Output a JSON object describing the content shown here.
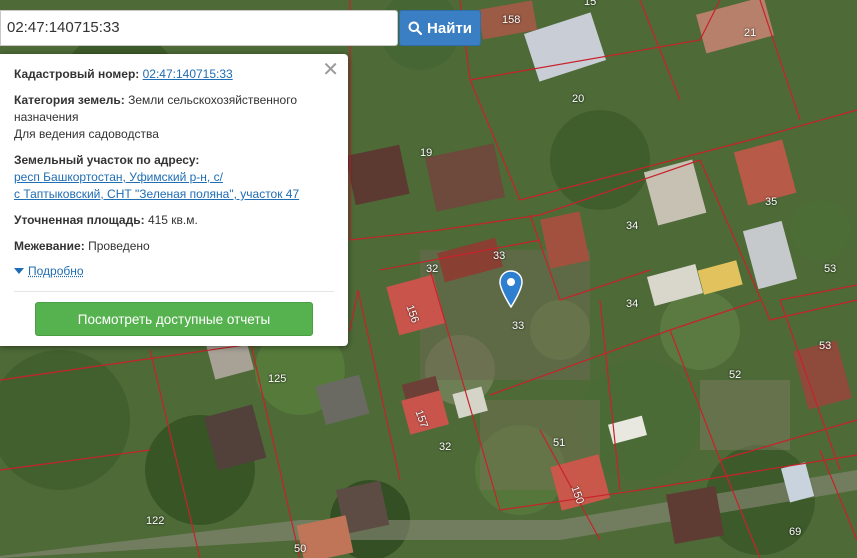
{
  "search": {
    "value": "02:47:140715:33",
    "button_label": "Найти"
  },
  "info": {
    "cadastral_label": "Кадастровый номер:",
    "cadastral_value": "02:47:140715:33",
    "category_label": "Категория земель:",
    "category_value": "Земли сельскохозяйственного назначения",
    "use": "Для ведения садоводства",
    "address_label": "Земельный участок по адресу:",
    "address_line1": "респ Башкортостан, Уфимский р-н, с/",
    "address_line2": "с Таптыковский, СНТ \"Зеленая поляна\", участок 47",
    "area_label": "Уточненная площадь:",
    "area_value": "415 кв.м.",
    "survey_label": "Межевание:",
    "survey_value": "Проведено",
    "more_label": "Подробно",
    "report_button": "Посмотреть доступные отчеты"
  },
  "map": {
    "parcel_numbers": [
      "158",
      "15",
      "21",
      "20",
      "19",
      "35",
      "34",
      "33",
      "32",
      "53",
      "156",
      "52",
      "125",
      "157",
      "51",
      "150",
      "122",
      "50",
      "69"
    ],
    "colors": {
      "parcel_border": "#c8222a",
      "marker": "#2f7fd1",
      "accent_button": "#3a7fc3",
      "report_button": "#56b24f"
    },
    "marker_icon": "map-pin-icon"
  }
}
